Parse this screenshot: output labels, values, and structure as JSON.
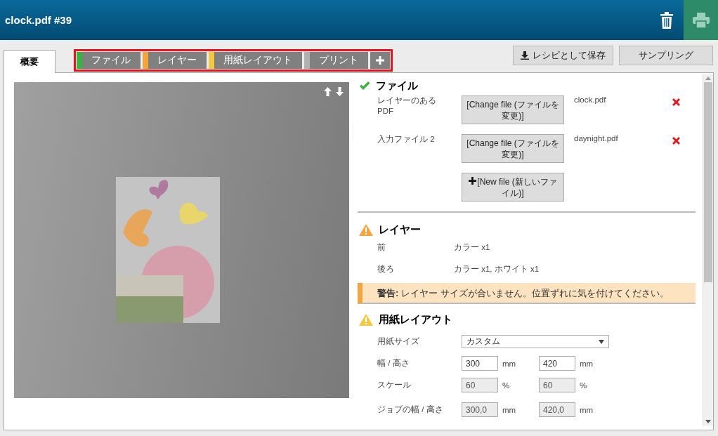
{
  "header": {
    "title": "clock.pdf #39"
  },
  "tabs": [
    {
      "label": "概要",
      "selected": true
    }
  ],
  "steps": [
    {
      "label": "ファイル",
      "color": "#3cb043"
    },
    {
      "label": "レイヤー",
      "color": "#f5a53c"
    },
    {
      "label": "用紙レイアウト",
      "color": "#f5c842"
    },
    {
      "label": "プリント",
      "color": "#b0b0b0"
    }
  ],
  "actions": [
    {
      "label": "レシピとして保存",
      "kind": "download"
    },
    {
      "label": "サンプリング",
      "kind": "plain"
    }
  ],
  "file_section": {
    "title": "ファイル",
    "kind": "ok",
    "color": "#3cb043",
    "rows": [
      {
        "label": "レイヤーのある PDF",
        "button": "[Change file (ファイルを変更)]",
        "filename": "clock.pdf"
      },
      {
        "label": "入力ファイル 2",
        "button": "[Change file (ファイルを変更)]",
        "filename": "daynight.pdf"
      }
    ],
    "new_file_button": "[New file (新しいファイル)]"
  },
  "layer_section": {
    "title": "レイヤー",
    "kind": "warning",
    "color": "#f5a53c",
    "rows": [
      {
        "label": "前",
        "value": "カラー x1"
      },
      {
        "label": "後ろ",
        "value": "カラー x1, ホワイト x1"
      }
    ],
    "warning": "**警告:** レイヤー サイズが合いません。位置ずれに気を付けてください。"
  },
  "paper_section": {
    "title": "用紙レイアウト",
    "kind": "warning",
    "color": "#f5c842",
    "paper_size": {
      "label": "用紙サイズ",
      "value": "カスタム"
    },
    "rows": [
      {
        "label": "幅 / 高さ",
        "fields": [
          {
            "value": "300",
            "unit": "mm",
            "disabled": false
          },
          {
            "value": "420",
            "unit": "mm",
            "disabled": false
          }
        ]
      },
      {
        "label": "スケール",
        "fields": [
          {
            "value": "60",
            "unit": "%",
            "disabled": true
          },
          {
            "value": "60",
            "unit": "%",
            "disabled": true
          }
        ]
      },
      {
        "label": "ジョブの幅 / 高さ",
        "fields": [
          {
            "value": "300,0",
            "unit": "mm",
            "disabled": true
          },
          {
            "value": "420,0",
            "unit": "mm",
            "disabled": true
          }
        ]
      }
    ]
  }
}
